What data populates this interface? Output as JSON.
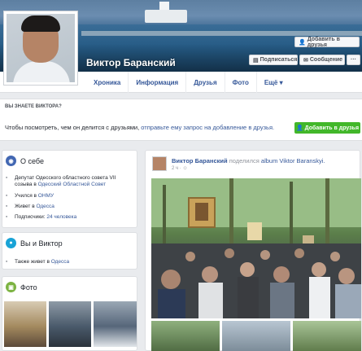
{
  "profile": {
    "name": "Виктор Баранский"
  },
  "cover_buttons": {
    "add_friend": "Добавить в друзья",
    "subscribe": "Подписаться",
    "message": "Сообщение",
    "more": "···"
  },
  "tabs": [
    "Хроника",
    "Информация",
    "Друзья",
    "Фото",
    "Ещё ▾"
  ],
  "know": {
    "title": "ВЫ ЗНАЕТЕ ВИКТОРА?",
    "text_plain": "Чтобы посмотреть, чем он делится с друзьями,",
    "text_link": "отправьте ему запрос на добавление в друзья.",
    "button": "Добавить в друзья"
  },
  "about": {
    "title": "О себе",
    "rows": [
      {
        "text": "Депутат Одесского областного совета VII созыва в",
        "link": "Одесский Областной Совет"
      },
      {
        "text": "Учился в",
        "link": "ОНМУ"
      },
      {
        "text": "Живет в",
        "link": "Одесса"
      },
      {
        "text": "Подписчики:",
        "link": "24 человека"
      }
    ]
  },
  "both": {
    "title": "Вы и Виктор",
    "row_text": "Также живет в",
    "row_link": "Одесса"
  },
  "photos": {
    "title": "Фото"
  },
  "post": {
    "author": "Виктор Баранский",
    "action": "поделился",
    "album": "album Viktor Baranskyi.",
    "meta": "2 ч · ☺"
  },
  "colors": {
    "link": "#365899",
    "green_button": "#42b72a",
    "about_icon": "#4267b2",
    "both_icon": "#19a3d6",
    "photos_icon": "#7cb342"
  }
}
